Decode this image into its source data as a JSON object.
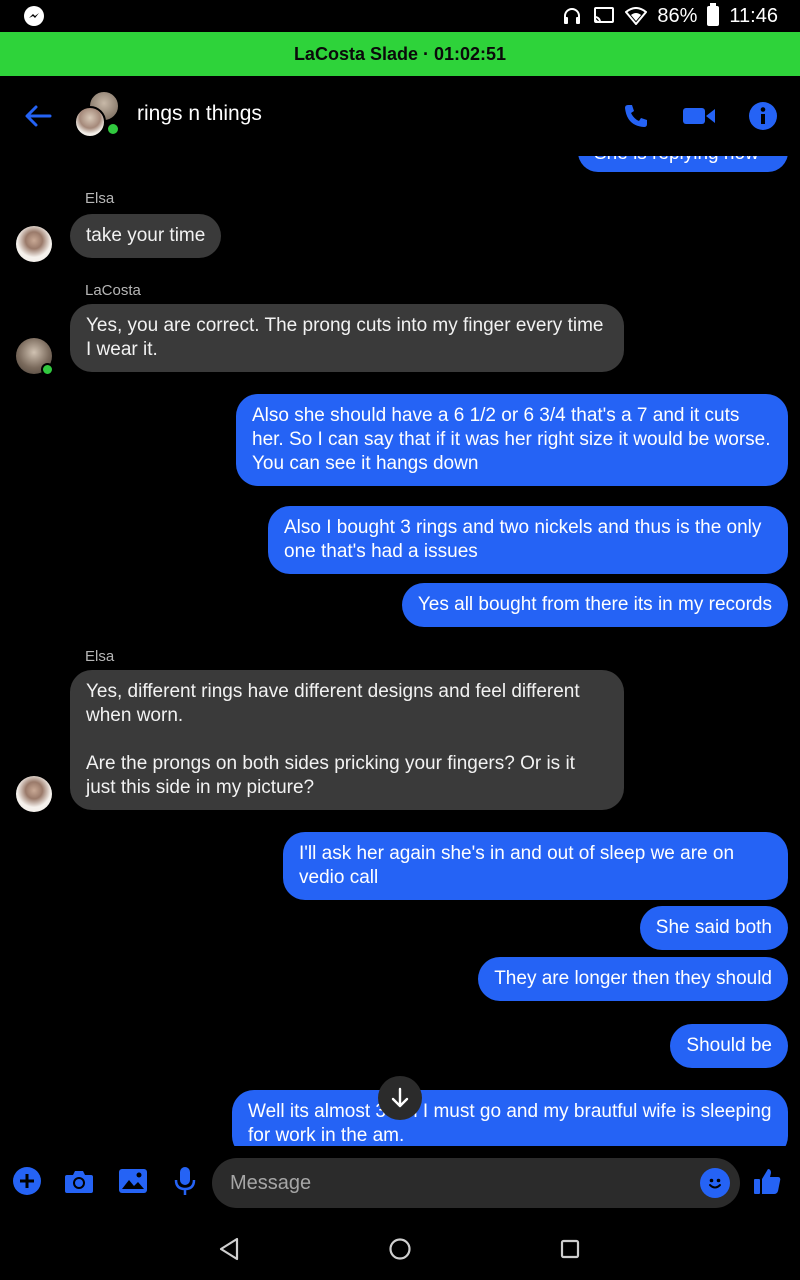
{
  "status_bar": {
    "battery": "86%",
    "time": "11:46"
  },
  "call_banner": {
    "name": "LaCosta Slade",
    "separator": "·",
    "duration": "01:02:51"
  },
  "header": {
    "title": "rings n things"
  },
  "colors": {
    "accent": "#2563f5",
    "call_banner": "#2ed33a",
    "incoming_bubble": "#3a3a3a",
    "online": "#31c93f"
  },
  "messages": [
    {
      "id": "m0",
      "dir": "out",
      "text": "She is replying now"
    },
    {
      "id": "m1",
      "dir": "in",
      "sender": "Elsa",
      "text": "take your time"
    },
    {
      "id": "m2",
      "dir": "in",
      "sender": "LaCosta",
      "text": "Yes, you are correct. The prong cuts into my finger every time I wear it."
    },
    {
      "id": "m3",
      "dir": "out",
      "text": "Also she should have a 6 1/2 or 6 3/4 that's a 7 and it cuts her. So I can say that if it was her right size it would be worse. You can see it hangs down"
    },
    {
      "id": "m4",
      "dir": "out",
      "text": "Also I bought 3 rings and two nickels and thus is the only one that's had a issues"
    },
    {
      "id": "m5",
      "dir": "out",
      "text": "Yes all bought from there its in my records"
    },
    {
      "id": "m6",
      "dir": "in",
      "sender": "Elsa",
      "text": "Yes, different rings have different designs and feel different when worn.\n\nAre the prongs on both sides pricking your fingers? Or is it just this side in my picture?"
    },
    {
      "id": "m7",
      "dir": "out",
      "text": "I'll ask her again she's in and out of sleep we are on vedio call"
    },
    {
      "id": "m8",
      "dir": "out",
      "text": "She said both"
    },
    {
      "id": "m9",
      "dir": "out",
      "text": "They are longer then they should"
    },
    {
      "id": "m10",
      "dir": "out",
      "text": "Should be"
    },
    {
      "id": "m11",
      "dir": "out",
      "text": "Well its almost 3 am I must go and my brautful wife is sleeping for work in the am."
    }
  ],
  "composer": {
    "placeholder": "Message"
  }
}
